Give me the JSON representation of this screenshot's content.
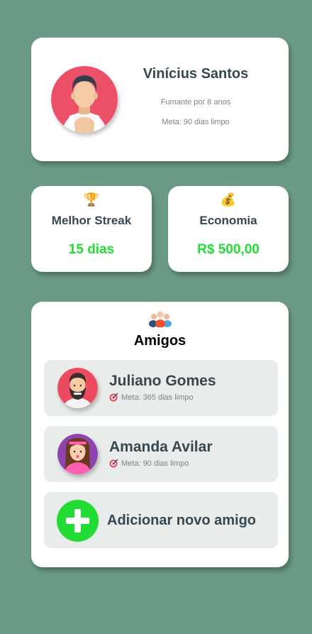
{
  "profile": {
    "name": "Vinícius Santos",
    "since": "Fumante por 8 anos",
    "goal": "Meta: 90 dias limpo",
    "avatar_icon": "man-avatar-icon"
  },
  "stats": {
    "streak": {
      "icon": "🏆",
      "label": "Melhor Streak",
      "value": "15 dias"
    },
    "savings": {
      "icon": "💰",
      "label": "Economia",
      "value": "R$ 500,00"
    }
  },
  "friends": {
    "icon": "people-group-icon",
    "title": "Amigos",
    "items": [
      {
        "name": "Juliano Gomes",
        "goal": "Meta: 365 dias limpo",
        "avatar_icon": "bearded-man-avatar-icon"
      },
      {
        "name": "Amanda Avilar",
        "goal": "Meta: 90 dias limpo",
        "avatar_icon": "woman-avatar-icon"
      }
    ],
    "add_label": "Adicionar novo amigo"
  },
  "colors": {
    "background": "#6b9b87",
    "accent_green": "#22dc34",
    "text_dark": "#37474f",
    "row_bg": "#e8edeb"
  }
}
